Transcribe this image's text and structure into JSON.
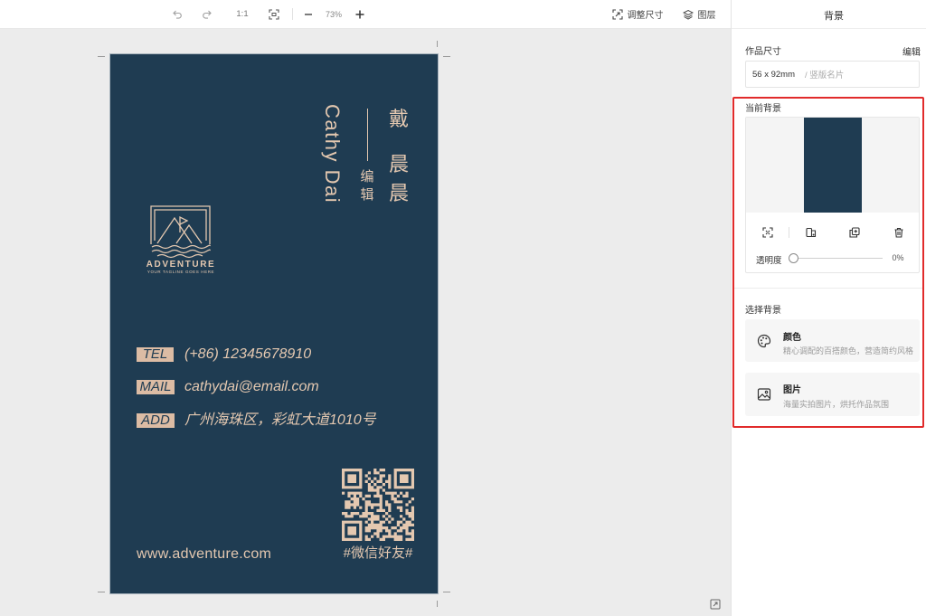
{
  "toolbar": {
    "undo_icon": "undo-icon",
    "redo_icon": "redo-icon",
    "ratio_label": "1:1",
    "fit_icon": "fit-screen-icon",
    "zoom_out_icon": "minus-icon",
    "zoom_level": "73%",
    "zoom_in_icon": "plus-icon",
    "resize_icon": "resize-icon",
    "resize_label": "调整尺寸",
    "layers_icon": "layers-icon",
    "layers_label": "图层"
  },
  "canvas": {
    "background": "#ececec",
    "expand_icon": "expand-icon"
  },
  "card": {
    "background": "#1f3c52",
    "accent": "#e4c8b0",
    "label_background": "#dcbca4",
    "name_chars": [
      "戴",
      "晨",
      "晨"
    ],
    "title_chars": [
      "编",
      "辑"
    ],
    "english_name": "Cathy Dai",
    "logo": {
      "icon": "mountain-logo-icon",
      "brand": "ADVENTURE",
      "tagline": "YOUR TAGLINE GOES HERE"
    },
    "contacts": [
      {
        "label": "TEL",
        "value": "(+86) 12345678910"
      },
      {
        "label": "MAIL",
        "value": "cathydai@email.com"
      },
      {
        "label": "ADD",
        "value": "广州海珠区，彩虹大道1010号"
      }
    ],
    "qr_icon": "qr-code-icon",
    "qr_caption": "#微信好友#",
    "website": "www.adventure.com"
  },
  "panel": {
    "title": "背景",
    "size": {
      "label": "作品尺寸",
      "edit_label": "编辑",
      "value": "56 x 92mm",
      "type": "/ 竖版名片"
    },
    "current_background": {
      "label": "当前背景",
      "actions": [
        {
          "icon": "fullscreen-icon"
        },
        {
          "icon": "replace-icon"
        },
        {
          "icon": "duplicate-icon"
        },
        {
          "icon": "trash-icon"
        }
      ],
      "opacity_label": "透明度",
      "opacity_value": "0%",
      "opacity": 0
    },
    "choose_background": {
      "label": "选择背景",
      "options": [
        {
          "icon": "palette-icon",
          "title": "颜色",
          "description": "精心调配的百搭颜色，营造简约风格"
        },
        {
          "icon": "image-icon",
          "title": "图片",
          "description": "海量实拍图片，烘托作品氛围"
        }
      ]
    },
    "highlight_color": "#e12b2b"
  }
}
